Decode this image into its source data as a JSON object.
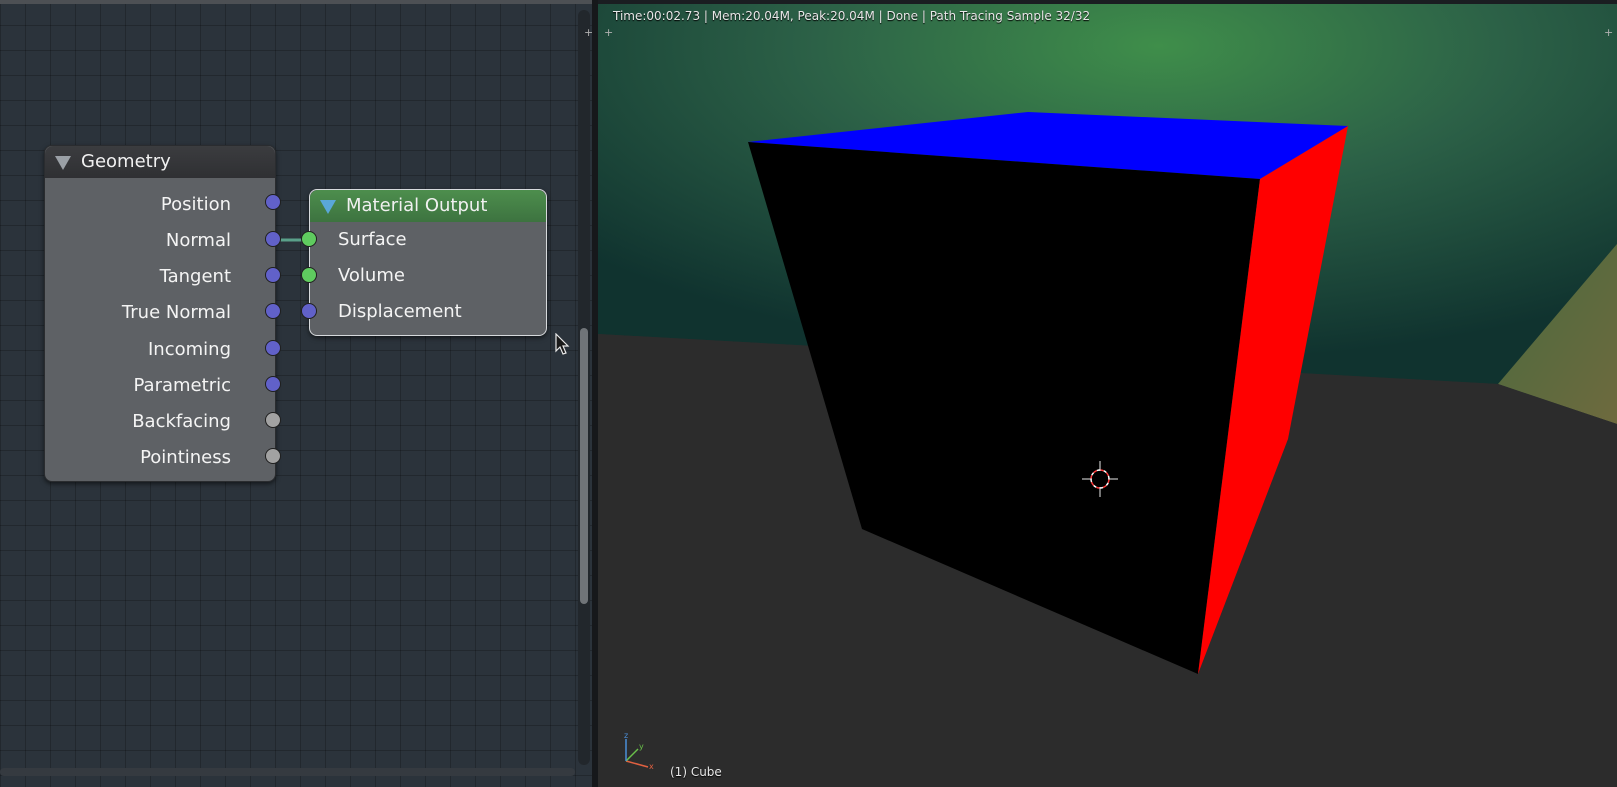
{
  "node_editor": {
    "geometry_node": {
      "title": "Geometry",
      "outputs": [
        {
          "label": "Position",
          "socket": "blue"
        },
        {
          "label": "Normal",
          "socket": "blue"
        },
        {
          "label": "Tangent",
          "socket": "blue"
        },
        {
          "label": "True Normal",
          "socket": "blue"
        },
        {
          "label": "Incoming",
          "socket": "blue"
        },
        {
          "label": "Parametric",
          "socket": "blue"
        },
        {
          "label": "Backfacing",
          "socket": "gray"
        },
        {
          "label": "Pointiness",
          "socket": "gray"
        }
      ]
    },
    "material_output_node": {
      "title": "Material Output",
      "inputs": [
        {
          "label": "Surface",
          "socket": "green"
        },
        {
          "label": "Volume",
          "socket": "green"
        },
        {
          "label": "Displacement",
          "socket": "blue"
        }
      ]
    },
    "link": {
      "from": "Normal",
      "to": "Surface"
    }
  },
  "viewport": {
    "status": "Time:00:02.73 | Mem:20.04M, Peak:20.04M | Done | Path Tracing Sample 32/32",
    "object_label": "(1) Cube",
    "cube_colors": {
      "front": "#000000",
      "top": "#0000ff",
      "right": "#ff0000"
    },
    "axis_labels": {
      "x": "x",
      "y": "y",
      "z": "z"
    }
  },
  "colors": {
    "socket_blue": "#6161c9",
    "socket_green": "#5fcb5f",
    "socket_gray": "#a2a2a2",
    "material_header": "#4d8e4d"
  }
}
